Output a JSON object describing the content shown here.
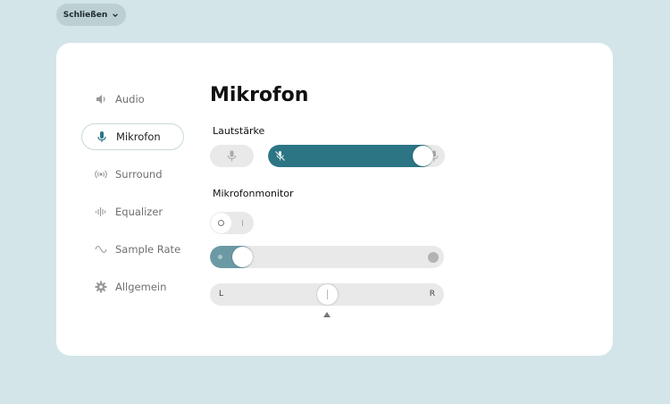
{
  "close_button": {
    "label": "Schließen",
    "icon": "chevron-down-icon"
  },
  "sidebar": {
    "items": [
      {
        "label": "Audio",
        "icon": "speaker-icon",
        "active": false
      },
      {
        "label": "Mikrofon",
        "icon": "microphone-icon",
        "active": true
      },
      {
        "label": "Surround",
        "icon": "surround-icon",
        "active": false
      },
      {
        "label": "Equalizer",
        "icon": "equalizer-icon",
        "active": false
      },
      {
        "label": "Sample Rate",
        "icon": "wave-icon",
        "active": false
      },
      {
        "label": "Allgemein",
        "icon": "gear-icon",
        "active": false
      }
    ]
  },
  "main": {
    "title": "Mikrofon",
    "volume": {
      "label": "Lautstärke",
      "level": 0.93,
      "mic_muted": false
    },
    "monitor": {
      "label": "Mikrofonmonitor",
      "enabled": false,
      "level": 0.1,
      "balance": 0.5,
      "balance_left_label": "L",
      "balance_right_label": "R"
    }
  },
  "colors": {
    "accent": "#2b7585",
    "background": "#d3e5e8",
    "panel": "#ffffff",
    "track": "#e9e9e9"
  }
}
